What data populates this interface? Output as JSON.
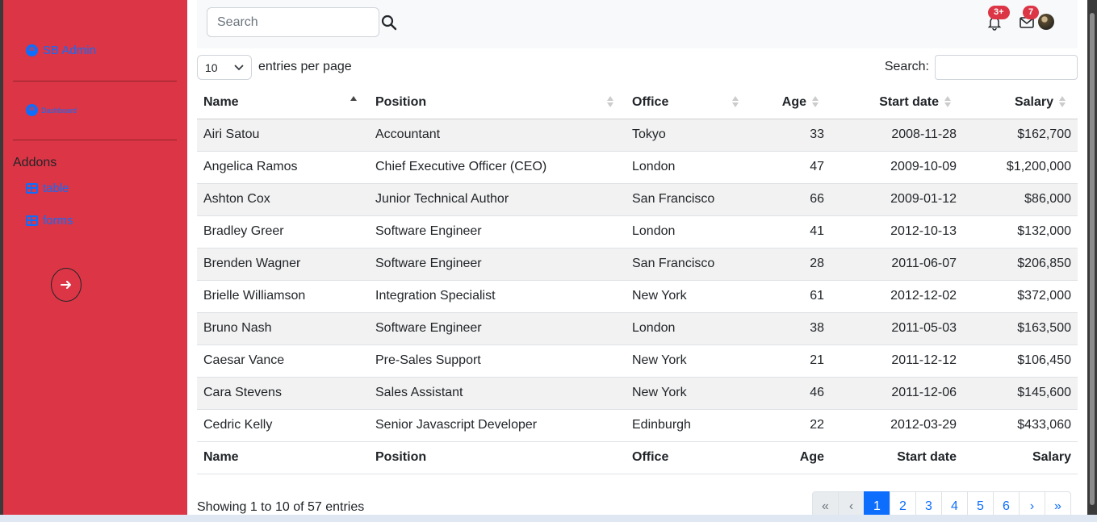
{
  "sidebar": {
    "brand": "SB Admin",
    "dashboard": "Dashboard",
    "addons_title": "Addons",
    "links": [
      "table",
      "forms"
    ]
  },
  "topbar": {
    "search_placeholder": "Search",
    "notifications_badge": "3+",
    "messages_badge": "7"
  },
  "datatable": {
    "per_page_value": "10",
    "per_page_label": "entries per page",
    "search_label": "Search:",
    "columns": [
      "Name",
      "Position",
      "Office",
      "Age",
      "Start date",
      "Salary"
    ],
    "sorted_column": "Name",
    "sort_direction": "ascending",
    "rows": [
      [
        "Airi Satou",
        "Accountant",
        "Tokyo",
        "33",
        "2008-11-28",
        "$162,700"
      ],
      [
        "Angelica Ramos",
        "Chief Executive Officer (CEO)",
        "London",
        "47",
        "2009-10-09",
        "$1,200,000"
      ],
      [
        "Ashton Cox",
        "Junior Technical Author",
        "San Francisco",
        "66",
        "2009-01-12",
        "$86,000"
      ],
      [
        "Bradley Greer",
        "Software Engineer",
        "London",
        "41",
        "2012-10-13",
        "$132,000"
      ],
      [
        "Brenden Wagner",
        "Software Engineer",
        "San Francisco",
        "28",
        "2011-06-07",
        "$206,850"
      ],
      [
        "Brielle Williamson",
        "Integration Specialist",
        "New York",
        "61",
        "2012-12-02",
        "$372,000"
      ],
      [
        "Bruno Nash",
        "Software Engineer",
        "London",
        "38",
        "2011-05-03",
        "$163,500"
      ],
      [
        "Caesar Vance",
        "Pre-Sales Support",
        "New York",
        "21",
        "2011-12-12",
        "$106,450"
      ],
      [
        "Cara Stevens",
        "Sales Assistant",
        "New York",
        "46",
        "2011-12-06",
        "$145,600"
      ],
      [
        "Cedric Kelly",
        "Senior Javascript Developer",
        "Edinburgh",
        "22",
        "2012-03-29",
        "$433,060"
      ]
    ],
    "info": "Showing 1 to 10 of 57 entries",
    "pagination": [
      "«",
      "‹",
      "1",
      "2",
      "3",
      "4",
      "5",
      "6",
      "›",
      "»"
    ],
    "active_page": "1"
  },
  "colors": {
    "sidebar_bg": "#dc3545",
    "link": "#0d6efd",
    "badge": "#dc3545"
  },
  "icons": [
    "user-circle-icon",
    "tachometer-icon",
    "table-icon",
    "search-icon",
    "bell-icon",
    "envelope-icon",
    "arrow-right-icon",
    "avatar"
  ]
}
